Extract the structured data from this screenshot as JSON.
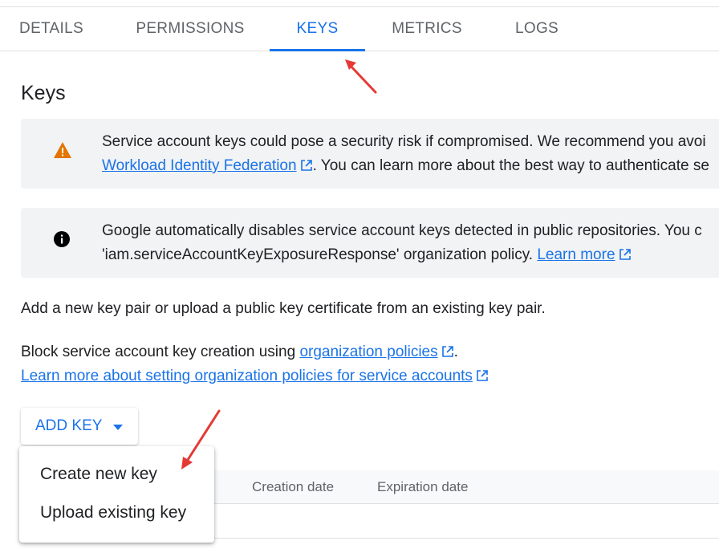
{
  "tabs": [
    {
      "label": "DETAILS",
      "active": false
    },
    {
      "label": "PERMISSIONS",
      "active": false
    },
    {
      "label": "KEYS",
      "active": true
    },
    {
      "label": "METRICS",
      "active": false
    },
    {
      "label": "LOGS",
      "active": false
    }
  ],
  "heading": "Keys",
  "warning_banner": {
    "icon": "warning-icon",
    "line1": "Service account keys could pose a security risk if compromised. We recommend you avoi",
    "link": "Workload Identity Federation",
    "line2_rest": ". You can learn more about the best way to authenticate se"
  },
  "info_banner": {
    "icon": "info-icon",
    "line1": "Google automatically disables service account keys detected in public repositories. You c",
    "line2_text": "'iam.serviceAccountKeyExposureResponse' organization policy.",
    "link": "Learn more"
  },
  "add_key_description": "Add a new key pair or upload a public key certificate from an existing key pair.",
  "block_text": {
    "prefix": "Block service account key creation using",
    "link": "organization policies",
    "suffix": ".",
    "learn_more_link": "Learn more about setting organization policies for service accounts"
  },
  "add_key_button": {
    "label": "ADD KEY",
    "icon": "arrow-drop-down-icon"
  },
  "table": {
    "headers": [
      "Creation date",
      "Expiration date"
    ]
  },
  "menu": {
    "items": [
      "Create new key",
      "Upload existing key"
    ]
  },
  "colors": {
    "accent": "#1a73e8",
    "warning": "#e37400",
    "annotation_arrow": "#e53935",
    "banner_bg": "#f1f3f4"
  }
}
